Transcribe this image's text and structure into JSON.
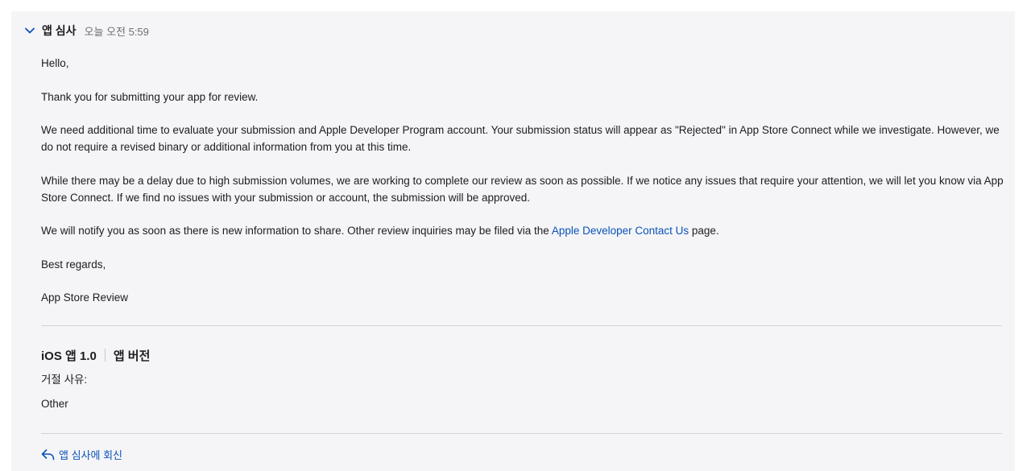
{
  "header": {
    "sender": "앱 심사",
    "time": "오늘 오전 5:59"
  },
  "message": {
    "greeting": "Hello,",
    "p1": "Thank you for submitting your app for review.",
    "p2": "We need additional time to evaluate your submission and Apple Developer Program account. Your submission status will appear as \"Rejected\" in App Store Connect while we investigate. However, we do not require a revised binary or additional information from you at this time.",
    "p3": "While there may be a delay due to high submission volumes, we are working to complete our review as soon as possible. If we notice any issues that require your attention, we will let you know via App Store Connect. If we find no issues with your submission or account, the submission will be approved.",
    "p4_before": "We will notify you as soon as there is new information to share. Other review inquiries may be filed via the ",
    "p4_link": "Apple Developer Contact Us",
    "p4_after": " page.",
    "closing": "Best regards,",
    "signature": "App Store Review"
  },
  "version": {
    "title": "iOS 앱 1.0",
    "subtitle": "앱 버전",
    "reason_label": "거절 사유:",
    "reason_value": "Other"
  },
  "reply": {
    "label": "앱 심사에 회신"
  },
  "colors": {
    "accent": "#0a53b8",
    "card_background": "#f5f5f7",
    "divider": "#d2d2d7"
  },
  "icons": {
    "collapse": "chevron-down-icon",
    "reply": "reply-arrow-icon"
  }
}
